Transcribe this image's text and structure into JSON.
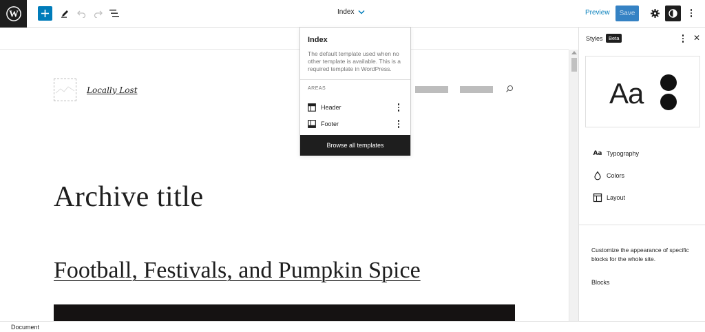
{
  "topbar": {
    "template_name": "Index",
    "preview_label": "Preview",
    "save_label": "Save",
    "icons": [
      "wordpress-logo",
      "plus-icon",
      "pencil-icon",
      "undo-icon",
      "redo-icon",
      "list-view-icon",
      "chevron-down-icon",
      "gear-icon",
      "half-circle-icon",
      "more-vertical-icon"
    ]
  },
  "canvas": {
    "site_title": "Locally Lost",
    "archive_title": "Archive title",
    "post_title": "Football, Festivals, and Pumpkin Spice"
  },
  "dropdown": {
    "title": "Index",
    "description": "The default template used when no other template is available. This is a required template in WordPress.",
    "areas_label": "AREAS",
    "areas": [
      {
        "label": "Header",
        "icon": "header-layout-icon"
      },
      {
        "label": "Footer",
        "icon": "footer-layout-icon"
      }
    ],
    "browse_label": "Browse all templates"
  },
  "sidebar": {
    "title": "Styles",
    "badge": "Beta",
    "preview_text": "Aa",
    "menu": [
      {
        "label": "Typography",
        "icon": "typography-icon"
      },
      {
        "label": "Colors",
        "icon": "droplet-icon"
      },
      {
        "label": "Layout",
        "icon": "layout-icon"
      }
    ],
    "description": "Customize the appearance of specific blocks for the whole site.",
    "blocks_label": "Blocks"
  },
  "footer": {
    "label": "Document"
  },
  "colors": {
    "accent": "#007cba",
    "dark": "#1e1e1e"
  }
}
